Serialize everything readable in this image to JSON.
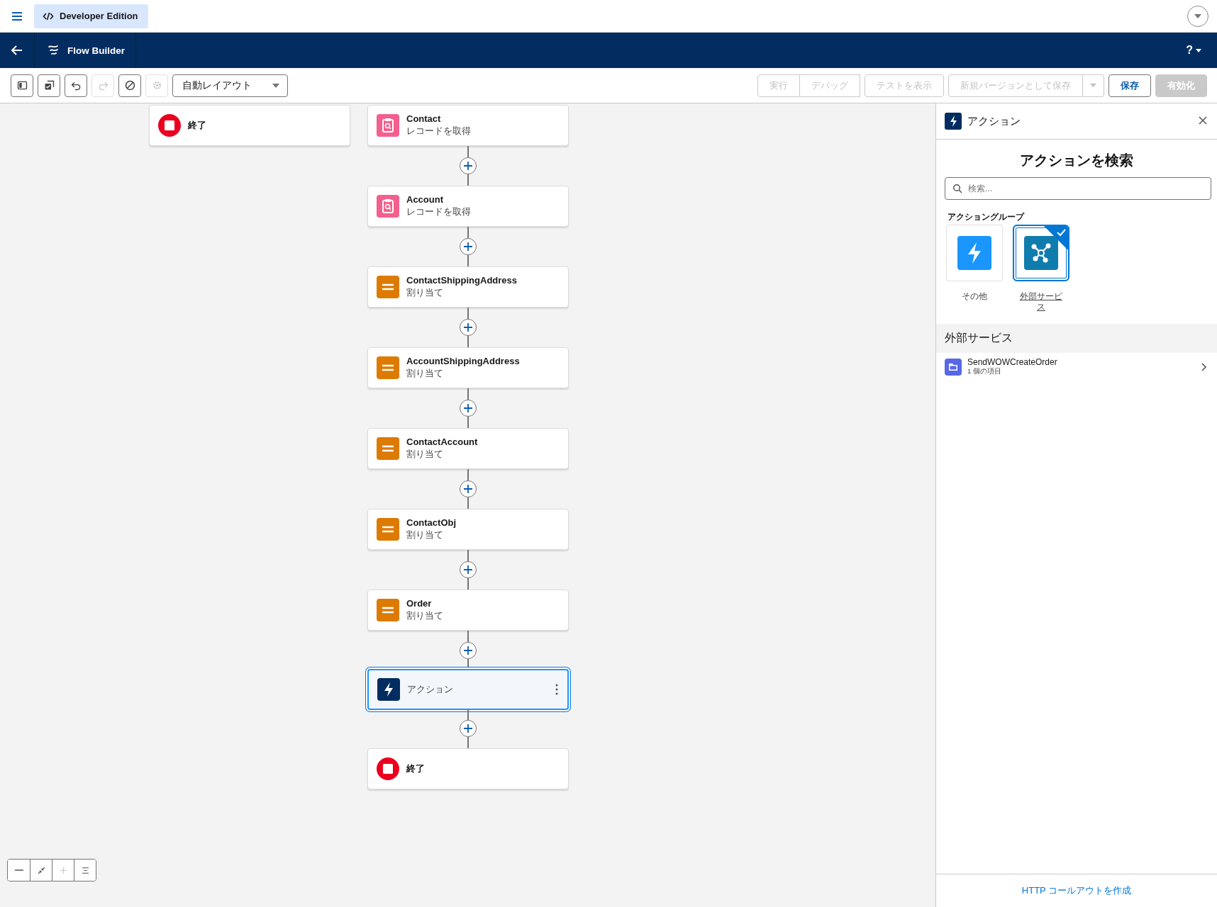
{
  "global_header": {
    "app_badge": "Developer Edition"
  },
  "nav_bar": {
    "title": "Flow Builder",
    "help": "?"
  },
  "toolbar": {
    "tools": [
      {
        "kind": "panel",
        "disabled": false
      },
      {
        "kind": "copy",
        "disabled": false
      },
      {
        "kind": "undo",
        "disabled": false
      },
      {
        "kind": "redo",
        "disabled": true
      },
      {
        "kind": "clear",
        "disabled": false
      },
      {
        "kind": "settings",
        "disabled": true
      }
    ],
    "layout_menu": "自動レイアウト",
    "run_buttons": [
      {
        "label": "実行",
        "disabled": true
      },
      {
        "label": "デバッグ",
        "disabled": true
      }
    ],
    "test_button": {
      "label": "テストを表示",
      "disabled": true
    },
    "save_as": {
      "label": "新規バージョンとして保存",
      "disabled": true
    },
    "save": {
      "label": "保存",
      "disabled": false
    },
    "activate": {
      "label": "有効化",
      "disabled": true
    }
  },
  "canvas": {
    "orphan_node": {
      "kind": "end",
      "title": "終了",
      "selected": false
    },
    "flow": [
      {
        "kind": "get_records",
        "title": "Contact",
        "subtitle": "レコードを取得",
        "selected": false
      },
      {
        "kind": "get_records",
        "title": "Account",
        "subtitle": "レコードを取得",
        "selected": false
      },
      {
        "kind": "assignment",
        "title": "ContactShippingAddress",
        "subtitle": "割り当て",
        "selected": false
      },
      {
        "kind": "assignment",
        "title": "AccountShippingAddress",
        "subtitle": "割り当て",
        "selected": false
      },
      {
        "kind": "assignment",
        "title": "ContactAccount",
        "subtitle": "割り当て",
        "selected": false
      },
      {
        "kind": "assignment",
        "title": "ContactObj",
        "subtitle": "割り当て",
        "selected": false
      },
      {
        "kind": "assignment",
        "title": "Order",
        "subtitle": "割り当て",
        "selected": false
      },
      {
        "kind": "action",
        "title": "アクション",
        "selected": true
      },
      {
        "kind": "end",
        "title": "終了",
        "selected": false
      }
    ],
    "zoom_controls": [
      {
        "kind": "zoom_out",
        "disabled": false
      },
      {
        "kind": "fit",
        "disabled": false
      },
      {
        "kind": "zoom_in",
        "disabled": true
      },
      {
        "kind": "center",
        "disabled": false
      }
    ]
  },
  "panel": {
    "title": "アクション",
    "heading": "アクションを検索",
    "search": {
      "placeholder": "検索..."
    },
    "groups_label": "アクショングループ",
    "groups": [
      {
        "kind": "other",
        "label": "その他",
        "selected": false
      },
      {
        "kind": "external",
        "label": "外部サービス",
        "selected": true
      }
    ],
    "section_title": "外部サービス",
    "items": [
      {
        "name": "SendWOWCreateOrder",
        "count": "1 個の項目"
      }
    ],
    "footer_link": "HTTP コールアウトを作成"
  }
}
